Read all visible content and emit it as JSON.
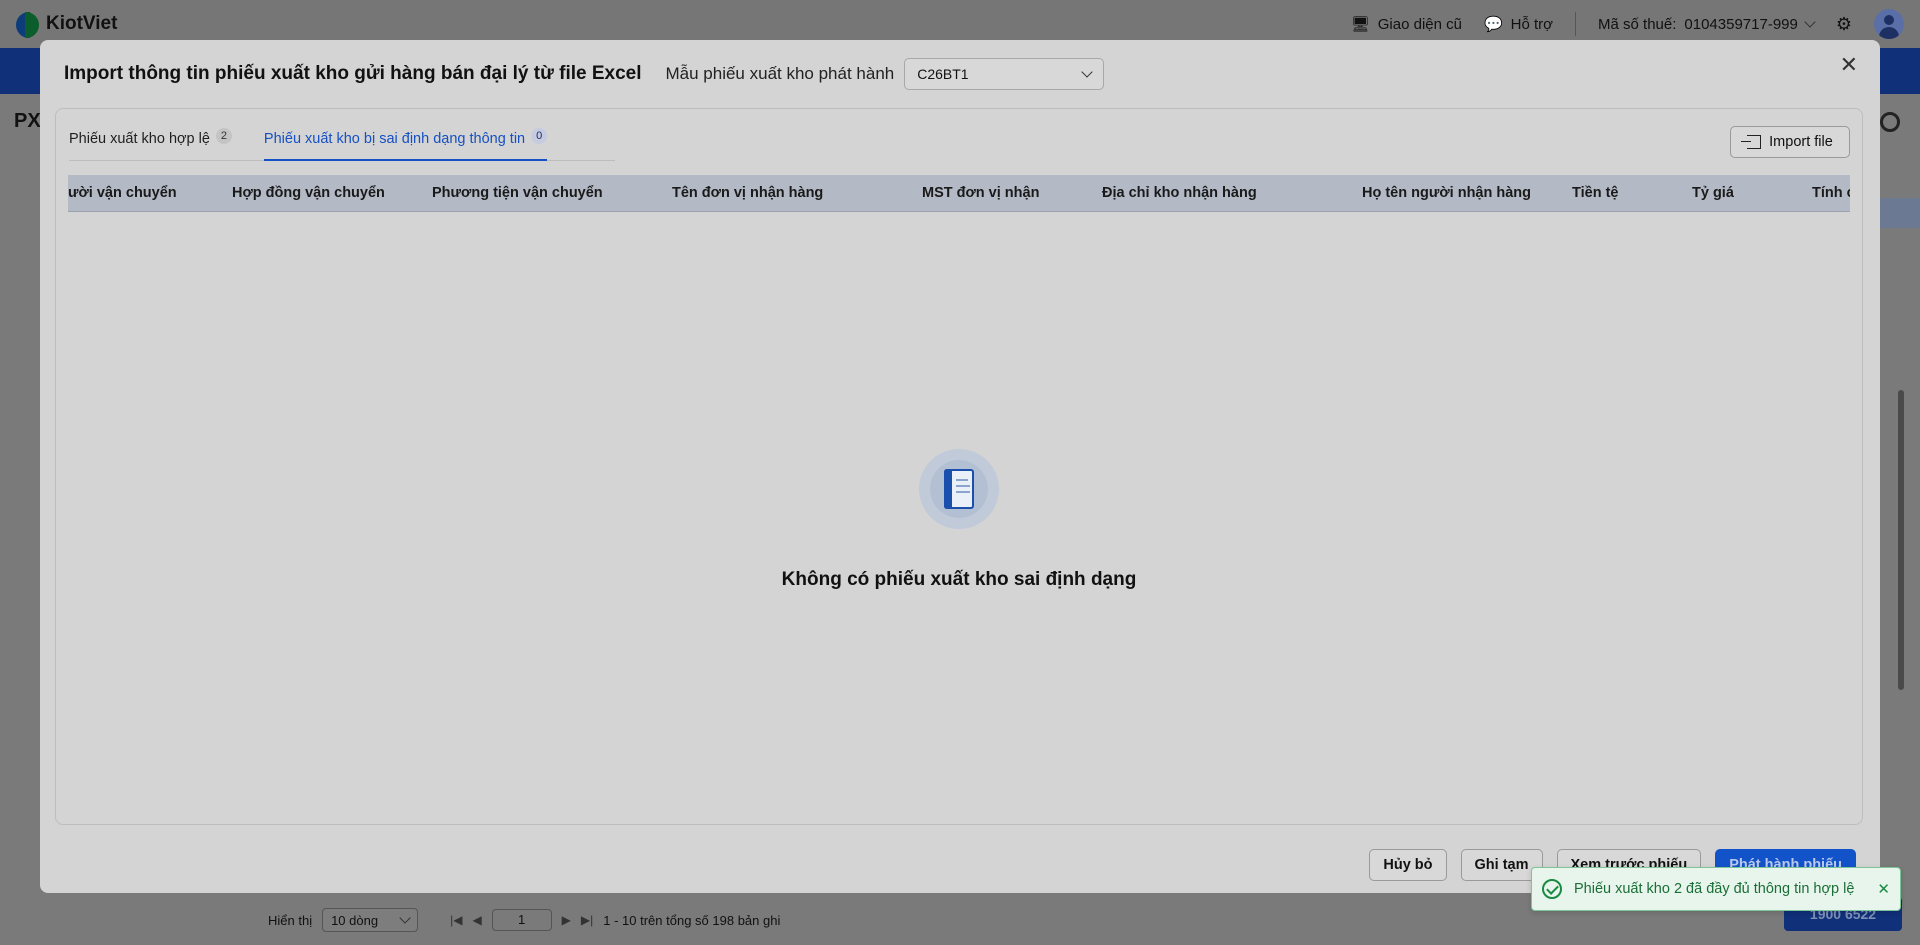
{
  "app": {
    "name": "KiotViet",
    "header": {
      "old_ui": "Giao diện cũ",
      "support": "Hỗ trợ",
      "tax_label": "Mã số thuế:",
      "tax_value": "0104359717-999"
    },
    "page_title": "PX",
    "footer": {
      "show_label": "Hiển thị",
      "rows_option": "10 dòng",
      "page_number": "1",
      "range_text": "1 - 10 trên tổng số 198 bản ghi"
    },
    "hotline": "1900 6522"
  },
  "modal": {
    "title": "Import thông tin phiếu xuất kho gửi hàng bán đại lý từ file Excel",
    "template_label": "Mẫu phiếu xuất kho phát hành",
    "template_value": "C26BT1",
    "tabs": [
      {
        "label": "Phiếu xuất kho hợp lệ",
        "count": "2"
      },
      {
        "label": "Phiếu xuất kho bị sai định dạng thông tin",
        "count": "0"
      }
    ],
    "import_button": "Import file",
    "columns": [
      "ười vận chuyển",
      "Hợp đồng vận chuyển",
      "Phương tiện vận chuyển",
      "Tên đơn vị nhận hàng",
      "MST đơn vị nhận",
      "Địa chỉ kho nhận hàng",
      "Họ tên người nhận hàng",
      "Tiền tệ",
      "Tỷ giá",
      "Tính c"
    ],
    "empty_message": "Không có phiếu xuất kho sai định dạng",
    "buttons": {
      "cancel": "Hủy bỏ",
      "save_draft": "Ghi tạm",
      "preview": "Xem trước phiếu",
      "publish": "Phát hành phiếu"
    }
  },
  "toast": {
    "message": "Phiếu xuất kho 2 đã đầy đủ thông tin hợp lệ"
  }
}
